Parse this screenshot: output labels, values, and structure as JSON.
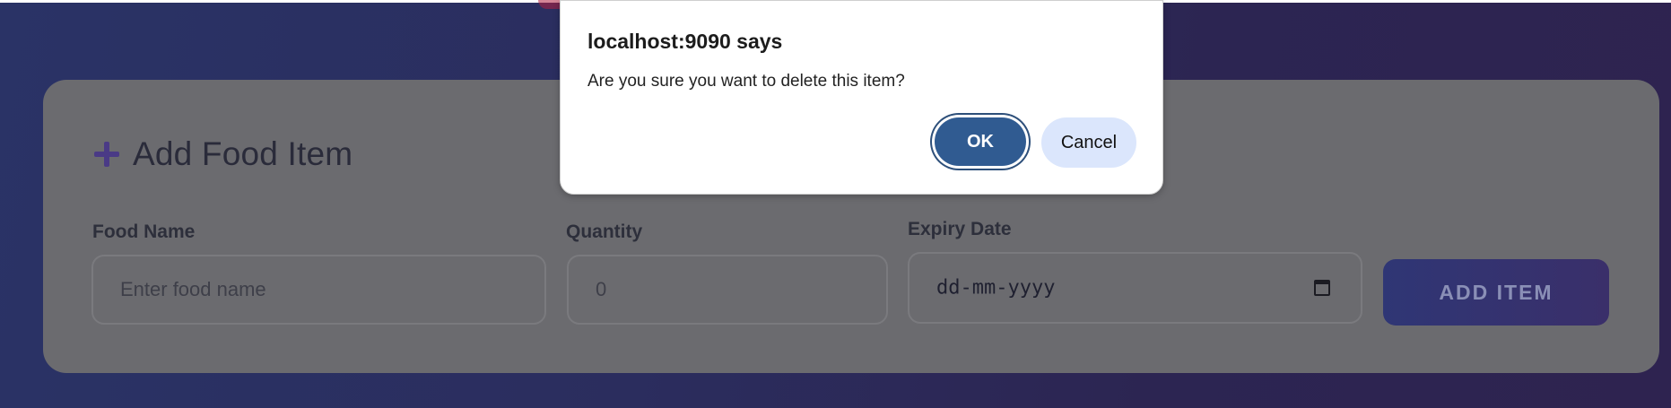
{
  "dialog": {
    "title": "localhost:9090 says",
    "message": "Are you sure you want to delete this item?",
    "ok_label": "OK",
    "cancel_label": "Cancel"
  },
  "form": {
    "title": "Add Food Item",
    "food_name": {
      "label": "Food Name",
      "placeholder": "Enter food name"
    },
    "quantity": {
      "label": "Quantity",
      "placeholder": "0"
    },
    "expiry_date": {
      "label": "Expiry Date",
      "placeholder": "dd-mm-yyyy"
    },
    "submit_label": "ADD ITEM"
  },
  "colors": {
    "dialog_ok": "#305b91",
    "dialog_cancel": "#dbe6fc",
    "card_dimmed": "#6b6b6f",
    "page_bg": "#2b2d5e"
  },
  "icons": {
    "title_icon": "plus-icon",
    "date_icon": "calendar-icon"
  }
}
